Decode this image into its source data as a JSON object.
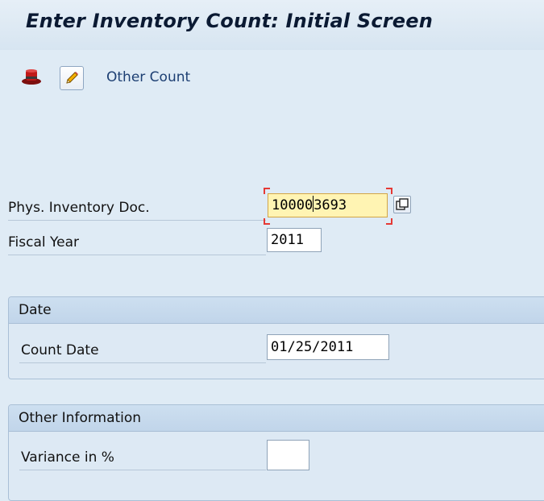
{
  "window": {
    "title": "Enter Inventory Count: Initial Screen"
  },
  "toolbar": {
    "buttons": [
      {
        "icon": "hat-icon",
        "label": ""
      },
      {
        "icon": "pencil-icon",
        "label": ""
      }
    ],
    "other_count_label": "Other Count"
  },
  "form": {
    "phys_inventory_doc": {
      "label": "Phys. Inventory Doc.",
      "value_before_cursor": "10000",
      "value_after_cursor": "3693"
    },
    "fiscal_year": {
      "label": "Fiscal Year",
      "value": "2011"
    }
  },
  "date_group": {
    "title": "Date",
    "count_date": {
      "label": "Count Date",
      "value": "01/25/2011"
    }
  },
  "other_info_group": {
    "title": "Other Information",
    "variance": {
      "label": "Variance in %",
      "value": ""
    }
  },
  "colors": {
    "background": "#dfebf5",
    "active_field": "#fff4b3",
    "focus_corners": "#e53935",
    "link_text": "#1d3f73"
  }
}
